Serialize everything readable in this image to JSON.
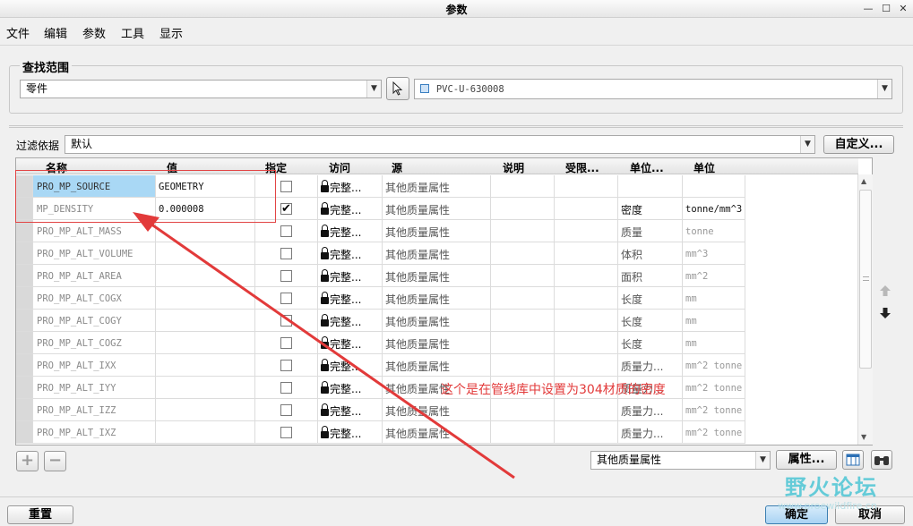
{
  "window": {
    "title": "参数",
    "minimize_glyph": "—",
    "maximize_glyph": "☐",
    "close_glyph": "✕"
  },
  "menu": [
    "文件",
    "编辑",
    "参数",
    "工具",
    "显示"
  ],
  "scope": {
    "legend": "查找范围",
    "type_value": "零件",
    "object_value": "PVC-U-630008"
  },
  "filter": {
    "label": "过滤依据",
    "value": "默认",
    "customize_label": "自定义..."
  },
  "table": {
    "headers": [
      "名称",
      "值",
      "指定",
      "访问",
      "源",
      "说明",
      "受限...",
      "单位...",
      "单位"
    ],
    "rows": [
      {
        "name": "PRO_MP_SOURCE",
        "value": "GEOMETRY",
        "checked": false,
        "access": "完整...",
        "source": "其他质量属性",
        "unit_quantity": "",
        "unit": ""
      },
      {
        "name": "MP_DENSITY",
        "value": "0.000008",
        "checked": true,
        "access": "完整...",
        "source": "其他质量属性",
        "unit_quantity": "密度",
        "unit": "tonne/mm^3"
      },
      {
        "name": "PRO_MP_ALT_MASS",
        "value": "",
        "checked": false,
        "access": "完整...",
        "source": "其他质量属性",
        "unit_quantity": "质量",
        "unit": "tonne"
      },
      {
        "name": "PRO_MP_ALT_VOLUME",
        "value": "",
        "checked": false,
        "access": "完整...",
        "source": "其他质量属性",
        "unit_quantity": "体积",
        "unit": "mm^3"
      },
      {
        "name": "PRO_MP_ALT_AREA",
        "value": "",
        "checked": false,
        "access": "完整...",
        "source": "其他质量属性",
        "unit_quantity": "面积",
        "unit": "mm^2"
      },
      {
        "name": "PRO_MP_ALT_COGX",
        "value": "",
        "checked": false,
        "access": "完整...",
        "source": "其他质量属性",
        "unit_quantity": "长度",
        "unit": "mm"
      },
      {
        "name": "PRO_MP_ALT_COGY",
        "value": "",
        "checked": false,
        "access": "完整...",
        "source": "其他质量属性",
        "unit_quantity": "长度",
        "unit": "mm"
      },
      {
        "name": "PRO_MP_ALT_COGZ",
        "value": "",
        "checked": false,
        "access": "完整...",
        "source": "其他质量属性",
        "unit_quantity": "长度",
        "unit": "mm"
      },
      {
        "name": "PRO_MP_ALT_IXX",
        "value": "",
        "checked": false,
        "access": "完整...",
        "source": "其他质量属性",
        "unit_quantity": "质量力...",
        "unit": "mm^2 tonne"
      },
      {
        "name": "PRO_MP_ALT_IYY",
        "value": "",
        "checked": false,
        "access": "完整...",
        "source": "其他质量属性",
        "unit_quantity": "质量力...",
        "unit": "mm^2 tonne"
      },
      {
        "name": "PRO_MP_ALT_IZZ",
        "value": "",
        "checked": false,
        "access": "完整...",
        "source": "其他质量属性",
        "unit_quantity": "质量力...",
        "unit": "mm^2 tonne"
      },
      {
        "name": "PRO_MP_ALT_IXZ",
        "value": "",
        "checked": false,
        "access": "完整...",
        "source": "其他质量属性",
        "unit_quantity": "质量力...",
        "unit": "mm^2 tonne"
      }
    ]
  },
  "bottom_tools": {
    "source_filter_value": "其他质量属性",
    "properties_label": "属性..."
  },
  "buttons": {
    "reset": "重置",
    "ok": "确定",
    "cancel": "取消"
  },
  "annotation": {
    "text": "这个是在管线库中设置为304材质的密度",
    "color": "#e23a3a"
  },
  "watermark": {
    "text": "野火论坛",
    "url_text": "www.proewildfire.cn"
  }
}
